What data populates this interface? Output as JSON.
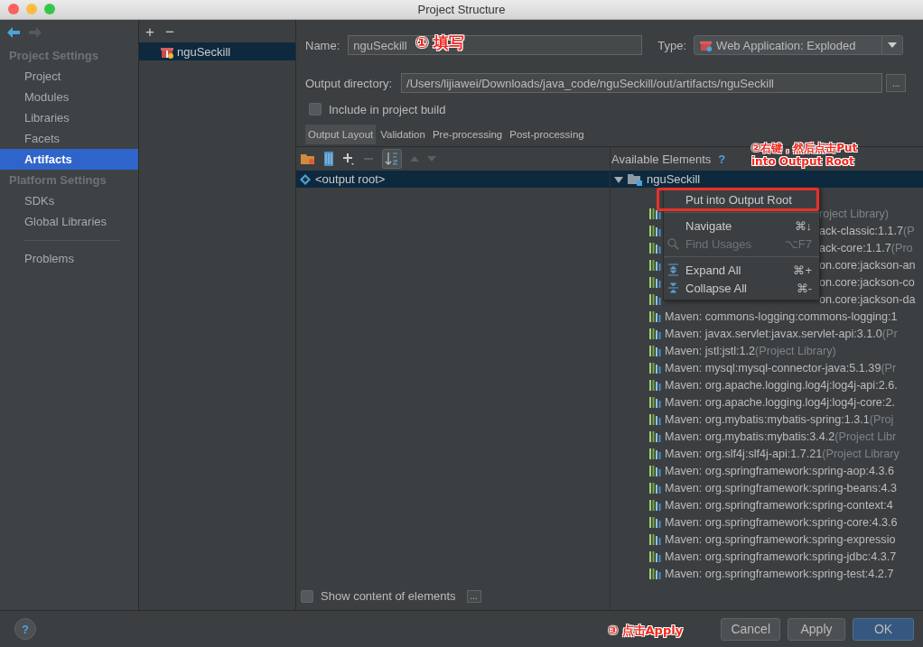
{
  "window": {
    "title": "Project Structure"
  },
  "sidebar": {
    "sections": [
      {
        "heading": "Project Settings",
        "items": [
          {
            "label": "Project",
            "selected": false
          },
          {
            "label": "Modules",
            "selected": false
          },
          {
            "label": "Libraries",
            "selected": false
          },
          {
            "label": "Facets",
            "selected": false
          },
          {
            "label": "Artifacts",
            "selected": true
          }
        ]
      },
      {
        "heading": "Platform Settings",
        "items": [
          {
            "label": "SDKs",
            "selected": false
          },
          {
            "label": "Global Libraries",
            "selected": false
          }
        ]
      }
    ],
    "footer_items": [
      {
        "label": "Problems",
        "selected": false
      }
    ]
  },
  "artifacts": {
    "add": "+",
    "remove": "−",
    "items": [
      {
        "label": "nguSeckill",
        "selected": true
      }
    ]
  },
  "form": {
    "name_label": "Name:",
    "name_value": "nguSeckill",
    "type_label": "Type:",
    "type_value": "Web Application: Exploded",
    "output_label": "Output directory:",
    "output_value": "/Users/lijiawei/Downloads/java_code/nguSeckill/out/artifacts/nguSeckill",
    "browse": "...",
    "include_label": "Include in project build",
    "include_checked": false
  },
  "tabs": [
    {
      "label": "Output Layout",
      "selected": true
    },
    {
      "label": "Validation",
      "selected": false
    },
    {
      "label": "Pre-processing",
      "selected": false
    },
    {
      "label": "Post-processing",
      "selected": false
    }
  ],
  "layout_tree": [
    {
      "label": "<output root>",
      "selected": true
    }
  ],
  "available": {
    "title": "Available Elements",
    "help": "?",
    "root": {
      "label": "nguSeckill",
      "expanded": true,
      "selected": true
    },
    "rows": [
      {
        "kind": "partial",
        "main": "",
        "suffix": "roject Library)"
      },
      {
        "kind": "partial",
        "main": "ack-classic:1.1.7",
        "suffix": "(P"
      },
      {
        "kind": "partial",
        "main": "ack-core:1.1.7",
        "suffix": "(Pro"
      },
      {
        "kind": "partial",
        "main": "on.core:jackson-an",
        "suffix": ""
      },
      {
        "kind": "partial",
        "main": "on.core:jackson-co",
        "suffix": ""
      },
      {
        "kind": "partial",
        "main": "on.core:jackson-da",
        "suffix": ""
      },
      {
        "kind": "full",
        "main": "Maven: commons-logging:commons-logging:1",
        "suffix": ""
      },
      {
        "kind": "full",
        "main": "Maven: javax.servlet:javax.servlet-api:3.1.0",
        "suffix": "(Pr"
      },
      {
        "kind": "full",
        "main": "Maven: jstl:jstl:1.2",
        "suffix": "(Project Library)"
      },
      {
        "kind": "full",
        "main": "Maven: mysql:mysql-connector-java:5.1.39",
        "suffix": "(Pr"
      },
      {
        "kind": "full",
        "main": "Maven: org.apache.logging.log4j:log4j-api:2.6.",
        "suffix": ""
      },
      {
        "kind": "full",
        "main": "Maven: org.apache.logging.log4j:log4j-core:2.",
        "suffix": ""
      },
      {
        "kind": "full",
        "main": "Maven: org.mybatis:mybatis-spring:1.3.1",
        "suffix": "(Proj"
      },
      {
        "kind": "full",
        "main": "Maven: org.mybatis:mybatis:3.4.2",
        "suffix": "(Project Libr"
      },
      {
        "kind": "full",
        "main": "Maven: org.slf4j:slf4j-api:1.7.21",
        "suffix": "(Project Library"
      },
      {
        "kind": "full",
        "main": "Maven: org.springframework:spring-aop:4.3.6",
        "suffix": ""
      },
      {
        "kind": "full",
        "main": "Maven: org.springframework:spring-beans:4.3",
        "suffix": ""
      },
      {
        "kind": "full",
        "main": "Maven: org.springframework:spring-context:4",
        "suffix": ""
      },
      {
        "kind": "full",
        "main": "Maven: org.springframework:spring-core:4.3.6",
        "suffix": ""
      },
      {
        "kind": "full",
        "main": "Maven: org.springframework:spring-expressio",
        "suffix": ""
      },
      {
        "kind": "full",
        "main": "Maven: org.springframework:spring-jdbc:4.3.7",
        "suffix": ""
      },
      {
        "kind": "full",
        "main": "Maven: org.springframework:spring-test:4.2.7",
        "suffix": ""
      }
    ]
  },
  "context_menu": [
    {
      "kind": "item",
      "label": "Put into Output Root",
      "disabled": false,
      "highlighted": true
    },
    {
      "kind": "separator"
    },
    {
      "kind": "item",
      "label": "Navigate",
      "shortcut": "⌘↓",
      "disabled": false,
      "highlighted": false
    },
    {
      "kind": "item",
      "label": "Find Usages",
      "shortcut": "⌥F7",
      "disabled": true,
      "highlighted": false
    },
    {
      "kind": "separator"
    },
    {
      "kind": "item",
      "label": "Expand All",
      "shortcut": "⌘+",
      "disabled": false,
      "highlighted": false
    },
    {
      "kind": "item",
      "label": "Collapse All",
      "shortcut": "⌘-",
      "disabled": false,
      "highlighted": false
    }
  ],
  "show_content": {
    "label": "Show content of elements",
    "checked": false,
    "more": "..."
  },
  "annotations": [
    {
      "number": "①",
      "text": "填写"
    },
    {
      "number": "②",
      "text": "右键，然后点击Put into  Output  Root"
    },
    {
      "number": "③",
      "text": "点击Apply"
    }
  ],
  "help_button": "?",
  "buttons": [
    {
      "label": "Cancel",
      "default": false
    },
    {
      "label": "Apply",
      "default": false
    },
    {
      "label": "OK",
      "default": true
    }
  ]
}
